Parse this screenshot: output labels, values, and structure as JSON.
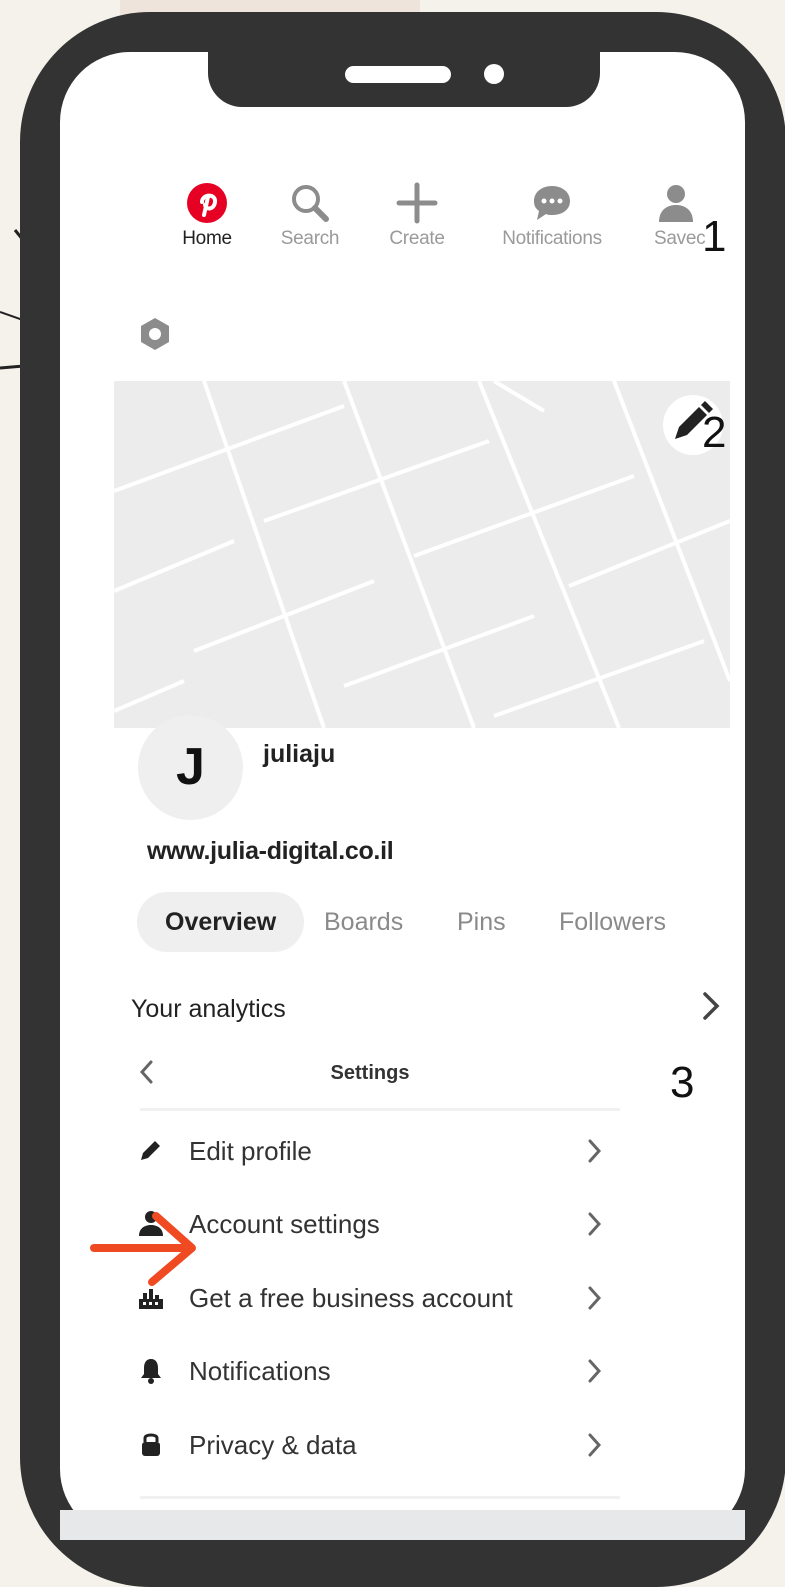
{
  "nav": {
    "items": [
      {
        "label": "Home",
        "icon": "pinterest-logo-icon",
        "active": true
      },
      {
        "label": "Search",
        "icon": "search-icon"
      },
      {
        "label": "Create",
        "icon": "plus-icon"
      },
      {
        "label": "Notifications",
        "icon": "chat-bubble-icon"
      },
      {
        "label": "Savec",
        "icon": "person-icon"
      }
    ]
  },
  "steps": {
    "one": "1",
    "two": "2",
    "three": "3"
  },
  "profile": {
    "avatar_letter": "J",
    "username": "juliaju",
    "website": "www.julia-digital.co.il"
  },
  "tabs": [
    {
      "label": "Overview",
      "active": true
    },
    {
      "label": "Boards"
    },
    {
      "label": "Pins"
    },
    {
      "label": "Followers"
    }
  ],
  "analytics": {
    "label": "Your analytics"
  },
  "settings": {
    "title": "Settings",
    "items": [
      {
        "label": "Edit profile",
        "icon": "pencil-icon"
      },
      {
        "label": "Account settings",
        "icon": "person-icon"
      },
      {
        "label": "Get a free business account",
        "icon": "business-icon"
      },
      {
        "label": "Notifications",
        "icon": "bell-icon"
      },
      {
        "label": "Privacy & data",
        "icon": "lock-icon"
      }
    ]
  },
  "colors": {
    "pinterest_red": "#e60023",
    "frame": "#333333",
    "arrow": "#f04a23",
    "muted": "#9a9a9a"
  }
}
